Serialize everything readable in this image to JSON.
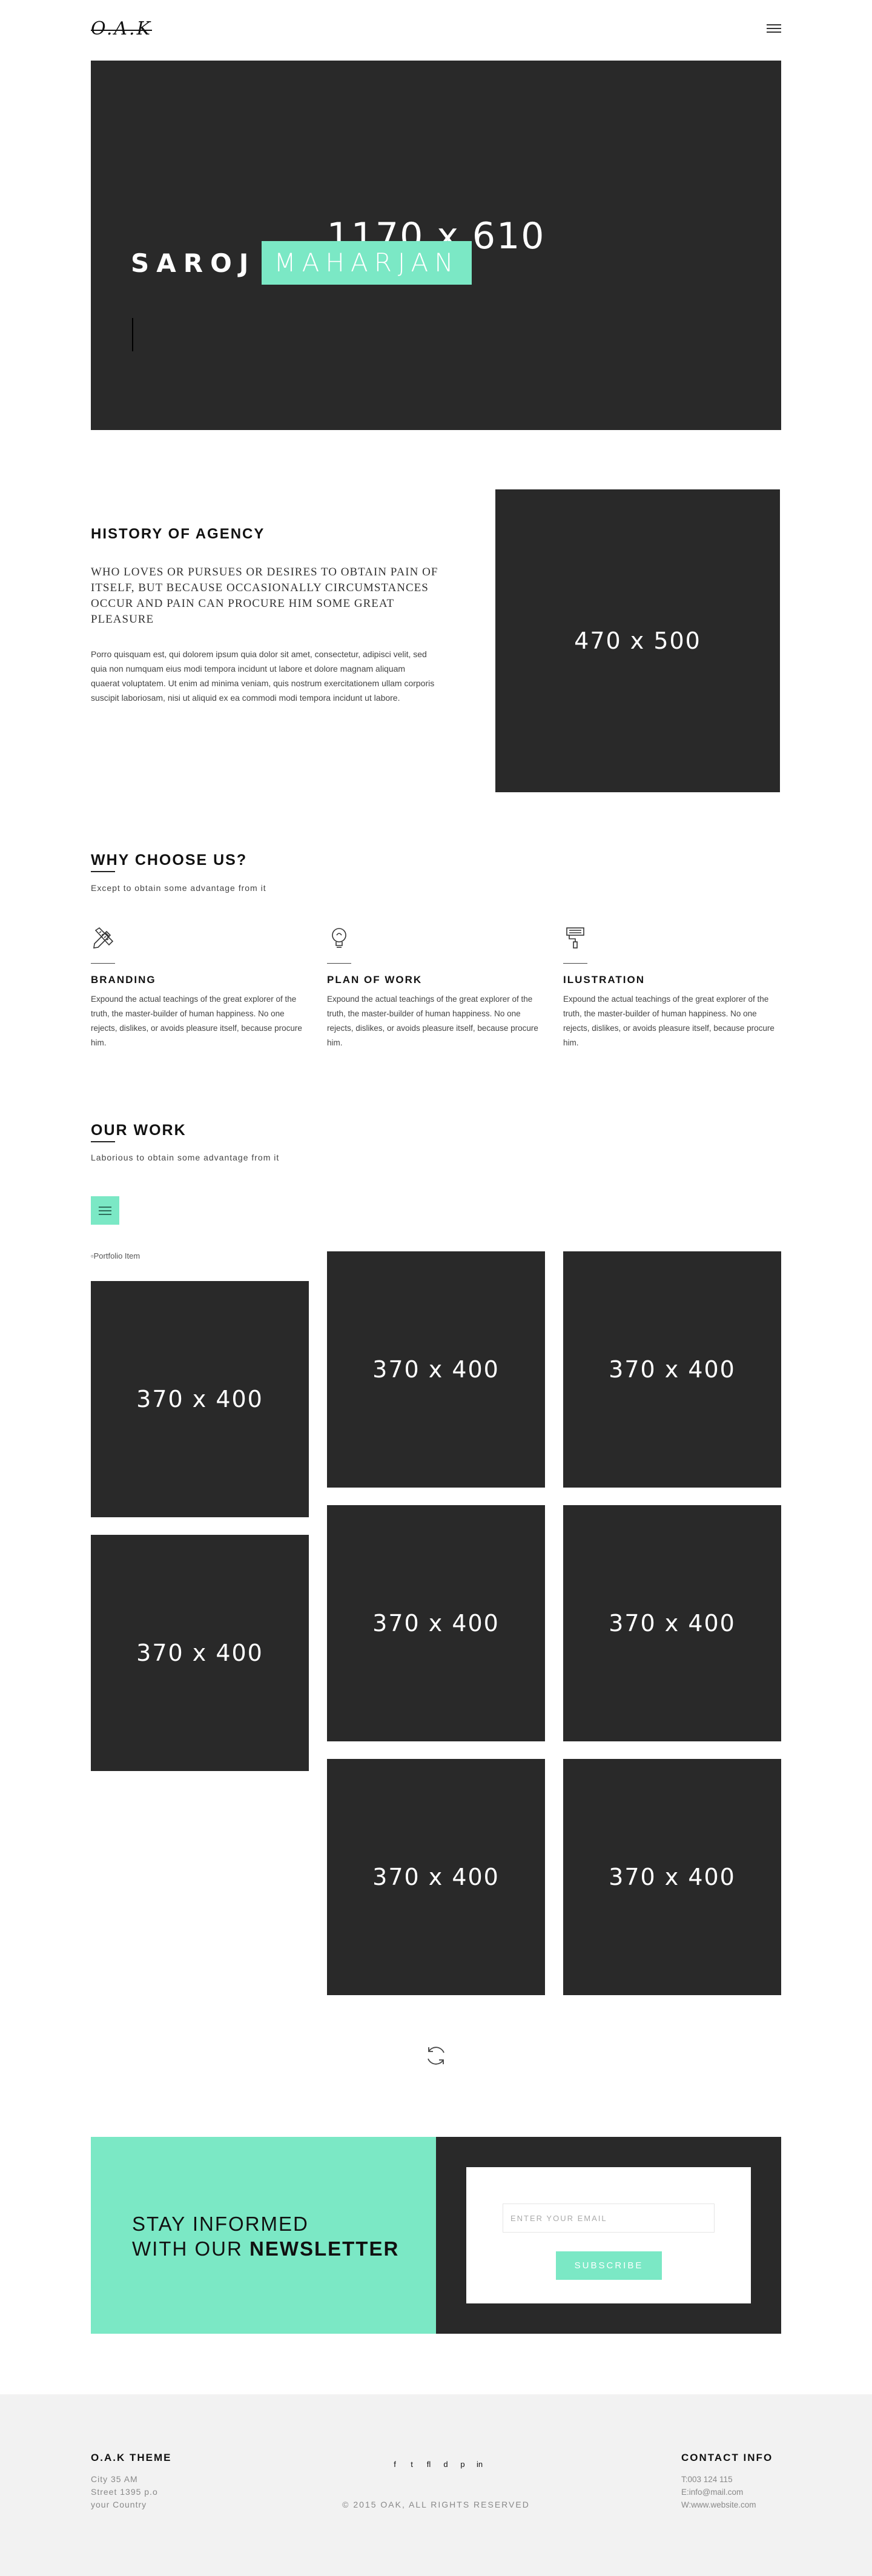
{
  "header": {
    "logo": "O.A.K"
  },
  "hero": {
    "placeholder": "1170 x 610",
    "first_name": "SAROJ",
    "last_name": "MAHARJAN"
  },
  "history": {
    "title": "HISTORY OF AGENCY",
    "subtitle": "WHO LOVES OR PURSUES OR DESIRES TO OBTAIN PAIN OF ITSELF, BUT BECAUSE OCCASIONALLY CIRCUMSTANCES OCCUR AND PAIN CAN PROCURE HIM SOME GREAT PLEASURE",
    "body": "Porro quisquam est, qui dolorem ipsum quia dolor sit amet, consectetur, adipisci velit, sed quia non numquam eius modi tempora incidunt ut labore et dolore magnam aliquam quaerat voluptatem. Ut enim ad minima veniam, quis nostrum exercitationem ullam corporis suscipit laboriosam, nisi ut aliquid ex ea commodi modi tempora incidunt ut labore.",
    "image_placeholder": "470 x 500"
  },
  "why": {
    "title": "WHY CHOOSE US?",
    "subtitle": "Except to obtain some advantage from it",
    "features": [
      {
        "icon": "pencil-ruler-icon",
        "title": "BRANDING",
        "text": "Expound the actual teachings of the great explorer of the truth, the master-builder of human happiness. No one rejects, dislikes, or avoids pleasure itself, because procure him."
      },
      {
        "icon": "lightbulb-icon",
        "title": "PLAN OF WORK",
        "text": "Expound the actual teachings of the great explorer of the truth, the master-builder of human happiness. No one rejects, dislikes, or avoids pleasure itself, because procure him."
      },
      {
        "icon": "paint-roller-icon",
        "title": "ILUSTRATION",
        "text": "Expound the actual teachings of the great explorer of the truth, the master-builder of human happiness. No one rejects, dislikes, or avoids pleasure itself, because procure him."
      }
    ]
  },
  "work": {
    "title": "OUR WORK",
    "subtitle": "Laborious to obtain some advantage from it",
    "broken_image_alt": "Portfolio Item",
    "tiles": [
      "370 x 400",
      "370 x 400",
      "370 x 400",
      "370 x 400",
      "370 x 400",
      "370 x 400",
      "370 x 400",
      "370 x 400"
    ]
  },
  "newsletter": {
    "line1": "STAY INFORMED",
    "line2_prefix": "WITH OUR",
    "line2_bold": "NEWSLETTER",
    "email_placeholder": "ENTER YOUR EMAIL",
    "subscribe_label": "SUBSCRIBE"
  },
  "footer": {
    "theme_title": "O.A.K THEME",
    "address": [
      "City 35 AM",
      "Street 1395 p.o",
      "your Country"
    ],
    "social": [
      "f",
      "t",
      "fl",
      "d",
      "p",
      "in"
    ],
    "copyright": "© 2015 OAK, ALL RIGHTS RESERVED",
    "contact_title": "CONTACT INFO",
    "contact": [
      "T:003 124 115",
      "E:info@mail.com",
      "W:www.website.com"
    ]
  },
  "colors": {
    "accent": "#7be8c5",
    "dark": "#292929",
    "footer_bg": "#f2f2f2"
  }
}
